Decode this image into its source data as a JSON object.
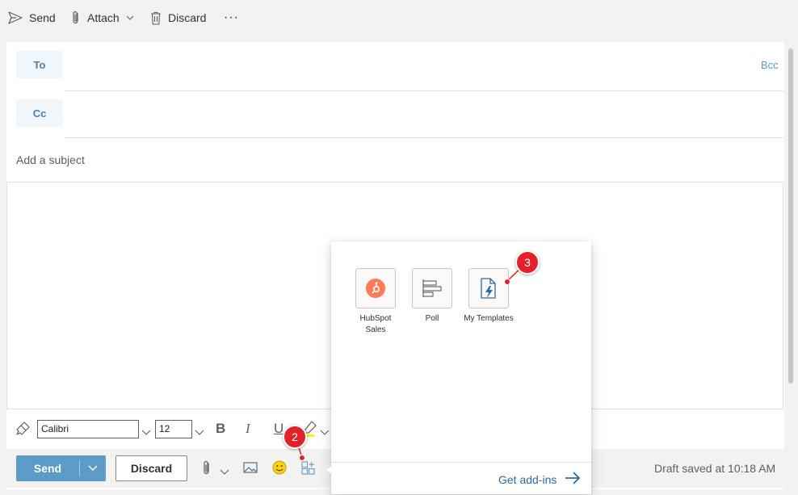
{
  "toolbar": {
    "send": "Send",
    "attach": "Attach",
    "discard": "Discard",
    "more": "···"
  },
  "fields": {
    "to_label": "To",
    "cc_label": "Cc",
    "bcc_label": "Bcc",
    "subject_placeholder": "Add a subject"
  },
  "format": {
    "font_name": "Calibri",
    "font_size": "12",
    "bold": "B",
    "italic": "I",
    "underline": "U"
  },
  "bottom": {
    "send_label": "Send",
    "discard_label": "Discard",
    "draft_status": "Draft saved at 10:18 AM"
  },
  "addins": {
    "items": [
      {
        "label_line1": "HubSpot",
        "label_line2": "Sales",
        "icon": "hubspot-icon"
      },
      {
        "label_line1": "Poll",
        "label_line2": "",
        "icon": "poll-icon"
      },
      {
        "label_line1": "My Templates",
        "label_line2": "",
        "icon": "templates-icon"
      }
    ],
    "get_addins": "Get add-ins"
  },
  "annotations": {
    "step_2": "2",
    "step_3": "3"
  },
  "colors": {
    "accent": "#5b9bc5",
    "badge": "#e2222b",
    "link": "#2b6ca3"
  }
}
